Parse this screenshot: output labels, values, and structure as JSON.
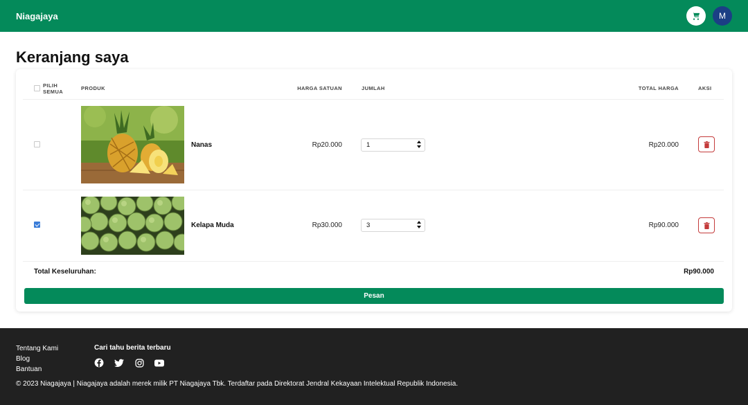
{
  "header": {
    "brand": "Niagajaya",
    "avatar_initial": "M",
    "cart_icon": "cart-icon"
  },
  "page": {
    "title": "Keranjang saya"
  },
  "table": {
    "headers": {
      "select_all": "Pilih Semua",
      "product": "Produk",
      "unit_price": "Harga Satuan",
      "quantity": "Jumlah",
      "total_price": "Total Harga",
      "action": "Aksi"
    },
    "rows": [
      {
        "name": "Nanas",
        "unit_price": "Rp20.000",
        "quantity": "1",
        "total_price": "Rp20.000",
        "checked": false,
        "image": "pineapple-photo"
      },
      {
        "name": "Kelapa Muda",
        "unit_price": "Rp30.000",
        "quantity": "3",
        "total_price": "Rp90.000",
        "checked": true,
        "image": "young-coconut-photo"
      }
    ],
    "grand_total_label": "Total Keseluruhan:",
    "grand_total_value": "Rp90.000",
    "order_button": "Pesan"
  },
  "footer": {
    "links": [
      "Tentang Kami",
      "Blog",
      "Bantuan"
    ],
    "news_title": "Cari tahu berita terbaru",
    "socials": [
      "facebook-icon",
      "twitter-icon",
      "instagram-icon",
      "youtube-icon"
    ],
    "copyright": "© 2023 Niagajaya | Niagajaya adalah merek milik PT Niagajaya Tbk. Terdaftar pada Direktorat Jendral Kekayaan Intelektual Republik Indonesia."
  },
  "colors": {
    "primary": "#048a5a",
    "avatar": "#1b3f85",
    "danger": "#c43a3a",
    "footer_bg": "#212121",
    "checkbox_checked": "#3b7dd8"
  }
}
